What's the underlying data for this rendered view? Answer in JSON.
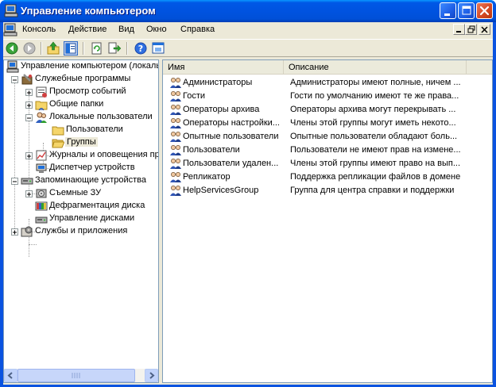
{
  "window": {
    "title": "Управление компьютером",
    "accent": "#0053E0"
  },
  "menubar": {
    "items": [
      {
        "label": "Консоль"
      },
      {
        "label": "Действие"
      },
      {
        "label": "Вид"
      },
      {
        "label": "Окно"
      },
      {
        "label": "Справка"
      }
    ]
  },
  "toolbar": {
    "buttons": [
      {
        "icon": "back-arrow-icon"
      },
      {
        "icon": "forward-arrow-icon"
      },
      {
        "icon": "up-folder-icon"
      },
      {
        "icon": "show-hide-tree-icon"
      },
      {
        "icon": "refresh-icon"
      },
      {
        "icon": "export-list-icon"
      },
      {
        "icon": "help-icon"
      },
      {
        "icon": "console-view-icon"
      }
    ]
  },
  "tree": {
    "items": [
      {
        "label": "Управление компьютером (локаль",
        "icon": "computer-management-icon"
      },
      {
        "label": "Служебные программы",
        "icon": "tools-icon"
      },
      {
        "label": "Просмотр событий",
        "icon": "event-viewer-icon"
      },
      {
        "label": "Общие папки",
        "icon": "shared-folders-icon"
      },
      {
        "label": "Локальные пользователи",
        "icon": "local-users-icon"
      },
      {
        "label": "Пользователи",
        "icon": "folder-icon"
      },
      {
        "label": "Группы",
        "icon": "folder-open-icon"
      },
      {
        "label": "Журналы и оповещения пр",
        "icon": "performance-logs-icon"
      },
      {
        "label": "Диспетчер устройств",
        "icon": "device-manager-icon"
      },
      {
        "label": "Запоминающие устройства",
        "icon": "storage-icon"
      },
      {
        "label": "Съемные ЗУ",
        "icon": "removable-storage-icon"
      },
      {
        "label": "Дефрагментация диска",
        "icon": "defrag-icon"
      },
      {
        "label": "Управление дисками",
        "icon": "disk-management-icon"
      },
      {
        "label": "Службы и приложения",
        "icon": "services-icon"
      }
    ]
  },
  "list": {
    "columns": [
      {
        "label": "Имя"
      },
      {
        "label": "Описание"
      }
    ],
    "rows": [
      {
        "name": "Администраторы",
        "description": "Администраторы имеют полные, ничем ..."
      },
      {
        "name": "Гости",
        "description": "Гости по умолчанию имеют те же права..."
      },
      {
        "name": "Операторы архива",
        "description": "Операторы архива могут перекрывать ..."
      },
      {
        "name": "Операторы настройки...",
        "description": "Члены этой группы могут иметь некото..."
      },
      {
        "name": "Опытные пользователи",
        "description": "Опытные пользователи обладают боль..."
      },
      {
        "name": "Пользователи",
        "description": "Пользователи не имеют прав на измене..."
      },
      {
        "name": "Пользователи удален...",
        "description": "Члены этой группы имеют право на вып..."
      },
      {
        "name": "Репликатор",
        "description": "Поддержка репликации файлов в домене"
      },
      {
        "name": "HelpServicesGroup",
        "description": "Группа для центра справки и поддержки"
      }
    ]
  }
}
